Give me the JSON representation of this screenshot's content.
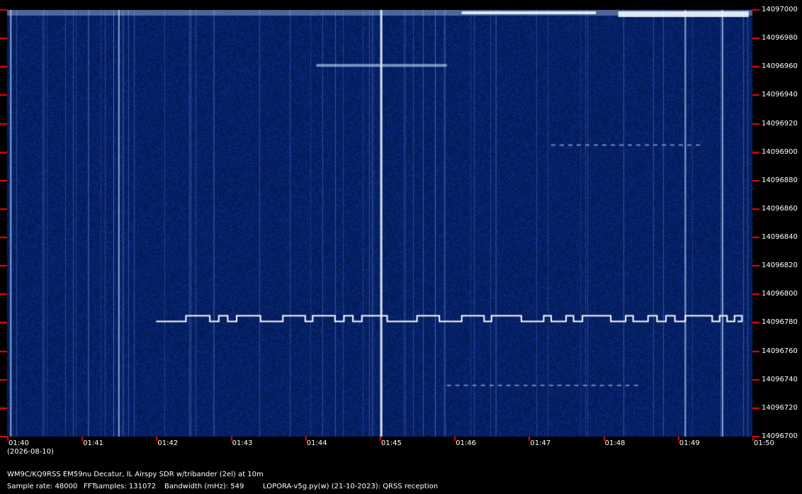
{
  "colors": {
    "background": "#000000",
    "waterfall_base": "#0a2a66",
    "signal": "#ffffff",
    "tick": "#ff0000"
  },
  "chart_data": {
    "type": "heatmap",
    "x_label_date": "(2026-08-10)",
    "x_ticks": [
      "01:40",
      "01:41",
      "01:42",
      "01:43",
      "01:44",
      "01:45",
      "01:46",
      "01:47",
      "01:48",
      "01:49",
      "01:50"
    ],
    "y_ticks": [
      14097000,
      14096980,
      14096960,
      14096940,
      14096920,
      14096900,
      14096880,
      14096860,
      14096840,
      14096820,
      14096800,
      14096780,
      14096760,
      14096740,
      14096720,
      14096700
    ],
    "xlim_minutes": [
      0,
      10
    ],
    "ylim": [
      14096700,
      14097000
    ],
    "fsk_trace": {
      "low_freq": 14096781,
      "high_freq": 14096785,
      "start_min": 2.0,
      "end_min": 9.8,
      "steps": [
        [
          2.0,
          0
        ],
        [
          2.4,
          1
        ],
        [
          2.72,
          0
        ],
        [
          2.84,
          1
        ],
        [
          2.96,
          0
        ],
        [
          3.08,
          1
        ],
        [
          3.4,
          0
        ],
        [
          3.7,
          1
        ],
        [
          4.0,
          0
        ],
        [
          4.1,
          1
        ],
        [
          4.4,
          0
        ],
        [
          4.52,
          1
        ],
        [
          4.64,
          0
        ],
        [
          4.76,
          1
        ],
        [
          5.1,
          0
        ],
        [
          5.5,
          1
        ],
        [
          5.8,
          0
        ],
        [
          6.1,
          1
        ],
        [
          6.4,
          0
        ],
        [
          6.5,
          1
        ],
        [
          6.9,
          0
        ],
        [
          7.2,
          1
        ],
        [
          7.3,
          0
        ],
        [
          7.5,
          1
        ],
        [
          7.6,
          0
        ],
        [
          7.72,
          1
        ],
        [
          8.1,
          0
        ],
        [
          8.3,
          1
        ],
        [
          8.4,
          0
        ],
        [
          8.6,
          1
        ],
        [
          8.72,
          0
        ],
        [
          8.84,
          1
        ],
        [
          8.96,
          0
        ],
        [
          9.1,
          1
        ],
        [
          9.46,
          0
        ],
        [
          9.56,
          1
        ],
        [
          9.66,
          0
        ],
        [
          9.76,
          1
        ],
        [
          9.86,
          0
        ]
      ]
    },
    "carriers_minutes": [
      0.05,
      1.5,
      5.02,
      9.1,
      9.6
    ]
  },
  "footer": {
    "line1": "WM9C/KQ9RSS EM59nu Decatur, IL  Airspy SDR w/tribander (2el) at 10m",
    "sample_rate": "Sample rate: 48000",
    "fft_samples": "FFTsamples: 131072",
    "bandwidth": "Bandwidth (mHz): 549",
    "software": "LOPORA-v5g.py(w) (21-10-2023): QRSS reception"
  }
}
